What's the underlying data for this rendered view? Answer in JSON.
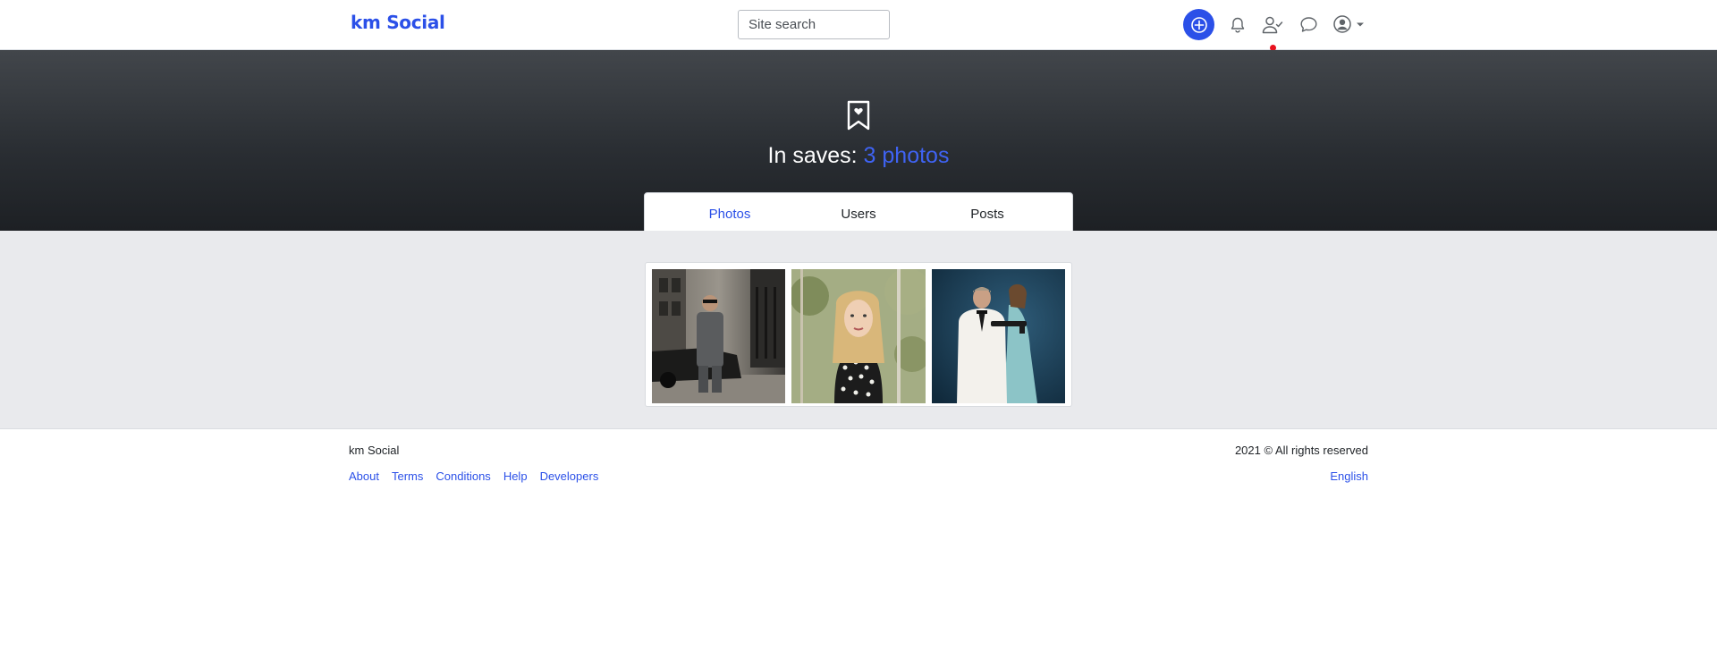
{
  "navbar": {
    "brand": "km Social",
    "search_placeholder": "Site search",
    "icons": [
      "plus-circle-icon",
      "bell-icon",
      "user-check-icon",
      "chat-icon",
      "account-icon",
      "caret-down-icon"
    ],
    "accent_color": "#2b50e8",
    "friend_requests_indicator_color": "#e8121e"
  },
  "hero": {
    "icon": "bookmark-heart-icon",
    "title_prefix": "In saves:",
    "title_count": "3 photos"
  },
  "tabs": [
    {
      "label": "Photos",
      "active": true
    },
    {
      "label": "Users",
      "active": false
    },
    {
      "label": "Posts",
      "active": false
    }
  ],
  "photos": [
    {
      "subject": "man in grey suit next to classic car on city street"
    },
    {
      "subject": "blonde woman in polka-dot top with greenery behind"
    },
    {
      "subject": "man in white tuxedo and woman in blue dress on dark blue background"
    }
  ],
  "footer": {
    "brand": "km Social",
    "links": [
      "About",
      "Terms",
      "Conditions",
      "Help",
      "Developers"
    ],
    "copyright": "2021 © All rights reserved",
    "language": "English"
  }
}
